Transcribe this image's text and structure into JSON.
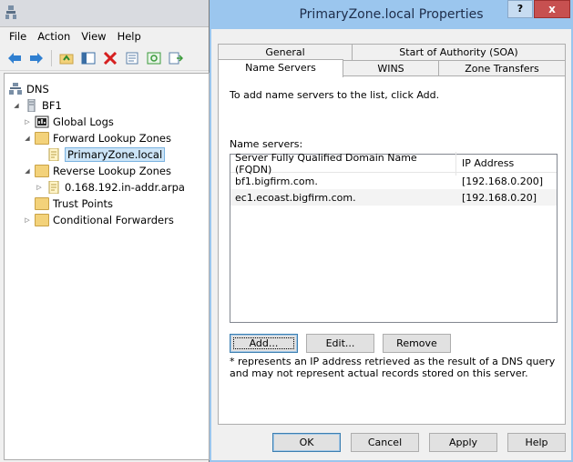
{
  "mmc": {
    "menu": [
      "File",
      "Action",
      "View",
      "Help"
    ],
    "tree": {
      "root": "DNS",
      "server": "BF1",
      "global_logs": "Global Logs",
      "forward_zones": "Forward Lookup Zones",
      "primary_zone": "PrimaryZone.local",
      "reverse_zones": "Reverse Lookup Zones",
      "reverse_zone_child": "0.168.192.in-addr.arpa",
      "trust_points": "Trust Points",
      "conditional_forwarders": "Conditional Forwarders"
    }
  },
  "dialog": {
    "title": "PrimaryZone.local Properties",
    "help_glyph": "?",
    "close_glyph": "x",
    "tabs_top": [
      "General",
      "Start of Authority (SOA)"
    ],
    "tabs_bottom": [
      "Name Servers",
      "WINS",
      "Zone Transfers"
    ],
    "active_tab": "Name Servers",
    "instruction": "To add name servers to the list, click Add.",
    "list_label": "Name servers:",
    "columns": [
      "Server Fully Qualified Domain Name (FQDN)",
      "IP Address"
    ],
    "rows": [
      {
        "fqdn": "bf1.bigfirm.com.",
        "ip": "[192.168.0.200]"
      },
      {
        "fqdn": "ec1.ecoast.bigfirm.com.",
        "ip": "[192.168.0.20]"
      }
    ],
    "buttons": {
      "add": "Add...",
      "edit": "Edit...",
      "remove": "Remove"
    },
    "footnote": "* represents an IP address retrieved as the result of a DNS query and may not represent actual records stored on this server.",
    "footer": {
      "ok": "OK",
      "cancel": "Cancel",
      "apply": "Apply",
      "help": "Help"
    }
  },
  "colors": {
    "title_bar": "#9bc6ee",
    "close_button": "#c75050",
    "folder": "#f3d27a"
  }
}
